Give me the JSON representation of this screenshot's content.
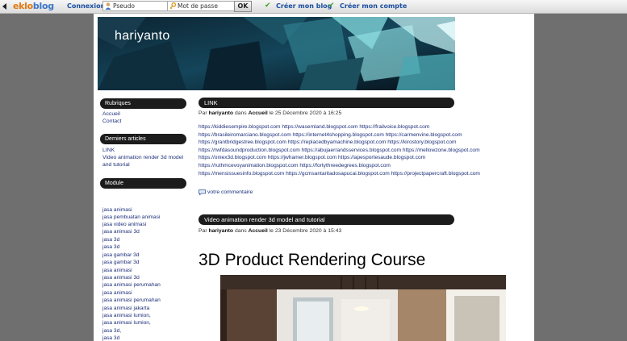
{
  "toolbar": {
    "logo_part1": "eklo",
    "logo_part2": "blog",
    "connexion_label": "Connexion :",
    "pseudo_placeholder": "Pseudo",
    "password_placeholder": "Mot de passe",
    "ok_label": "OK",
    "create_blog": "Créer mon blog",
    "create_account": "Créer mon compte",
    "brand_colors": {
      "logo_orange": "#e17a10",
      "logo_blue": "#3c76c8",
      "check_green": "#3aa31e"
    }
  },
  "banner": {
    "title": "hariyanto"
  },
  "sidebar": {
    "rubriques": {
      "heading": "Rubriques",
      "items": [
        "Accueil",
        "Contact"
      ]
    },
    "derniers": {
      "heading": "Derniers articles",
      "items": [
        "LINK",
        "Video animation render 3d model",
        "and tutorial"
      ]
    },
    "module": {
      "heading": "Module",
      "items": [
        "jasa animasi",
        "jasa pembuatan animasi",
        "jasa video animasi",
        "jasa animasi 3d",
        "jasa 3d",
        "jasa 3d",
        "jasa gambar 3d",
        "jasa gambar 3d",
        "jasa animasi",
        "jasa animasi 3d",
        "jasa animasi perumahan",
        "jasa animasi",
        "jasa animasi perumahan",
        "jasa animasi jakarta",
        "jasa animasi lumion,",
        "jasa animasi lumion,",
        "jasa 3d,",
        "jasa 3d"
      ]
    }
  },
  "posts": [
    {
      "title": "LINK",
      "meta": {
        "par": "Par",
        "author": "hariyanto",
        "dans": "dans",
        "category": "Accueil",
        "date": "le 25 Décembre 2020 à 16:25"
      },
      "url_lines": [
        "https://kiddiesempire.blogspot.com https://wasemland.blogspot.com https://frailvoice.blogspot.com",
        "https://brasileiromarciano.blogspot.com https://internet4shopping.blogspot.com https://carmenvine.blogspot.com",
        "https://grantbridgestree.blogspot.com https://replacedbyamachine.blogspot.com https://kirostory.blogspot.com",
        "https://rwfdasoundproduction.blogspot.com https://abujaerrandsservices.blogspot.com https://mellowzone.blogspot.com",
        "https://oniex3d.blogspot.com https://jwhamer.blogspot.com https://apesportesaude.blogspot.com",
        "https://ruthmcevoyanimation.blogspot.com https://fortythreedegrees.blogspot.com",
        "https://mensissuesinfo.blogspot.com https://gcmsantaritadosapucai.blogspot.com https://projectpapercraft.blogspot.com"
      ],
      "comment": "votre commentaire"
    },
    {
      "title": "Video animation render 3d model and tutorial",
      "meta": {
        "par": "Par",
        "author": "hariyanto",
        "dans": "dans",
        "category": "Accueil",
        "date": "le 23 Décembre 2020 à 15:43"
      },
      "heading": "3D Product Rendering Course"
    }
  ]
}
